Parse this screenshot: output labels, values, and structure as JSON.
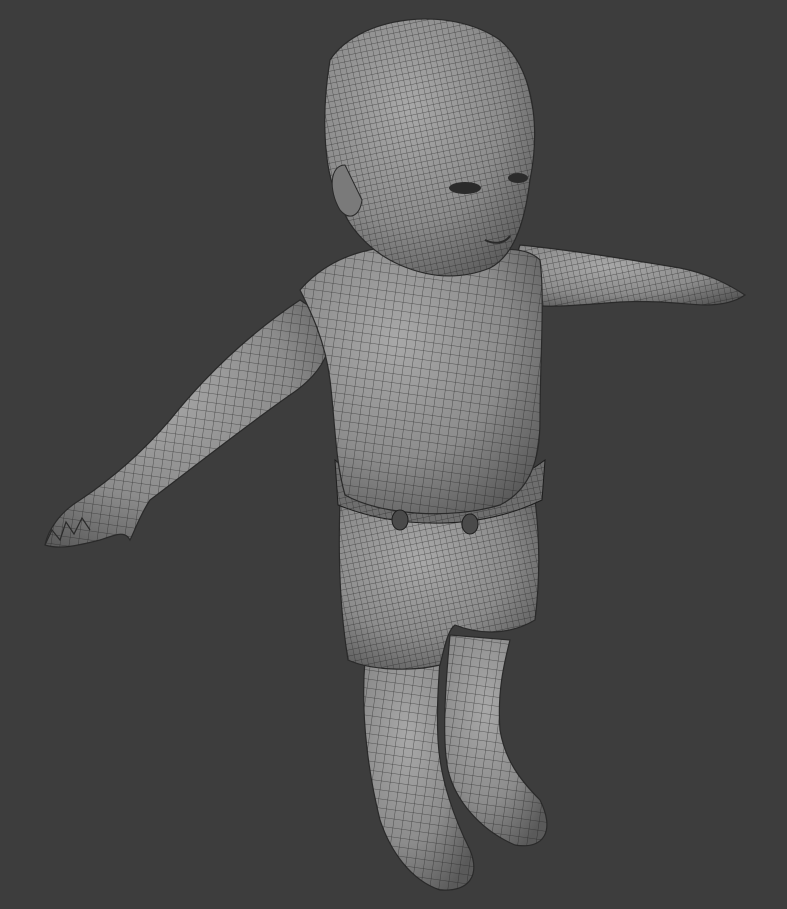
{
  "viewport": {
    "background_color": "#3d3d3d",
    "mode": "wireframe-overlay",
    "object": "child-character-mesh-t-pose"
  },
  "mesh": {
    "fill_color": "#8c8c8c",
    "shadow_color": "#5a5a5a",
    "highlight_color": "#a8a8a8",
    "wire_color": "#1e1e1e"
  }
}
